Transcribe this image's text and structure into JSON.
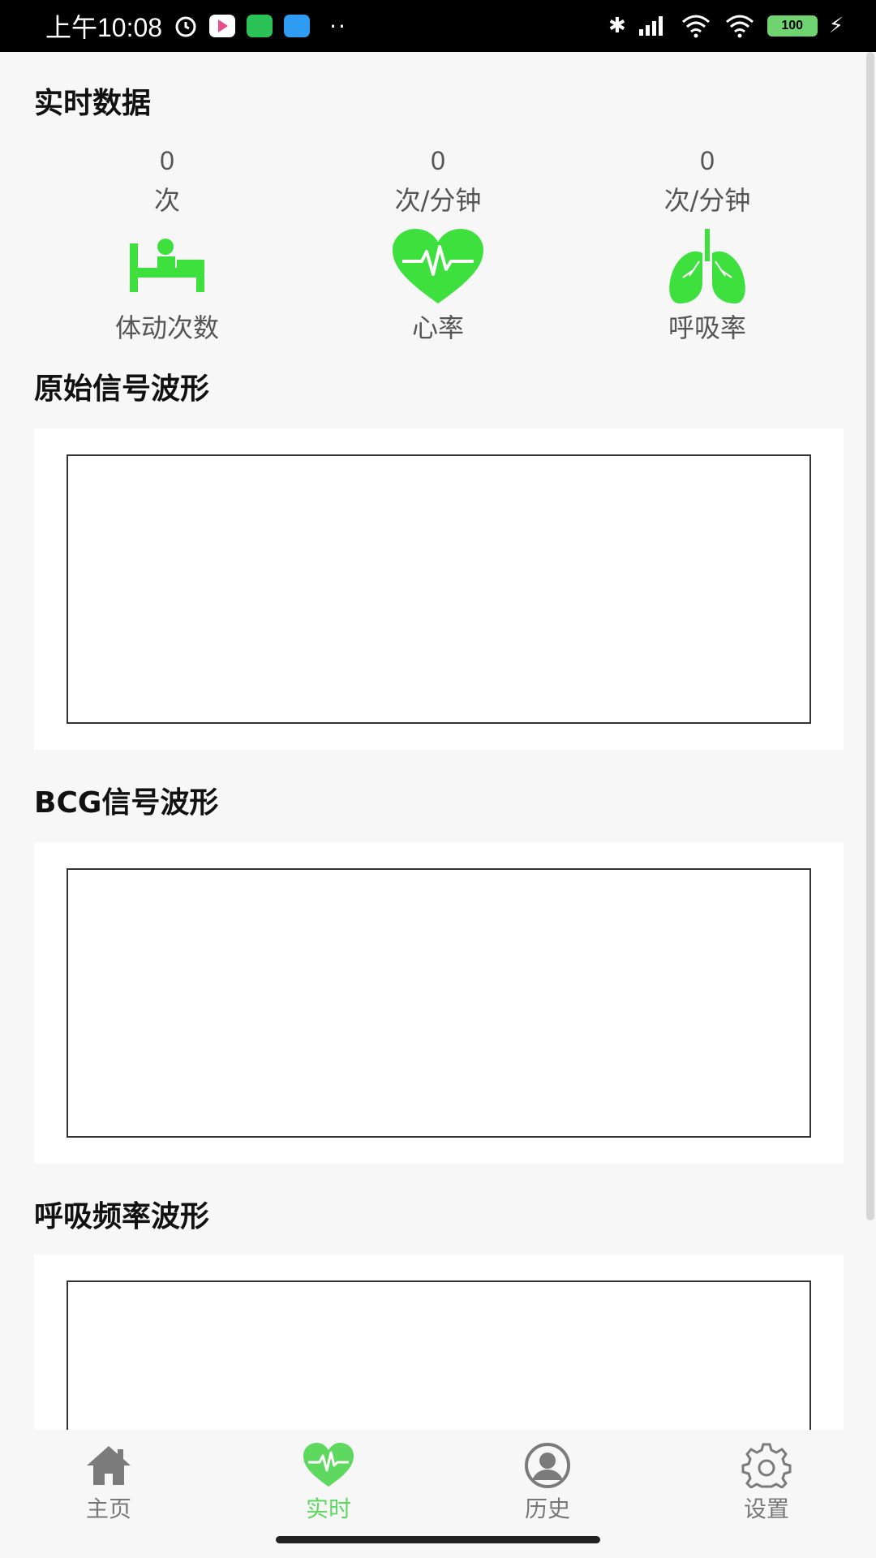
{
  "status_bar": {
    "time": "上午10:08",
    "battery": "100",
    "dots": "··"
  },
  "realtime": {
    "title": "实时数据",
    "stats": [
      {
        "value": "0",
        "unit": "次",
        "label": "体动次数",
        "icon": "bed-icon"
      },
      {
        "value": "0",
        "unit": "次/分钟",
        "label": "心率",
        "icon": "heart-pulse-icon"
      },
      {
        "value": "0",
        "unit": "次/分钟",
        "label": "呼吸率",
        "icon": "lungs-icon"
      }
    ]
  },
  "charts": [
    {
      "title": "原始信号波形"
    },
    {
      "title": "BCG信号波形"
    },
    {
      "title": "呼吸频率波形"
    }
  ],
  "bottom_nav": {
    "items": [
      {
        "label": "主页",
        "icon": "home-icon",
        "active": false
      },
      {
        "label": "实时",
        "icon": "heart-pulse-icon",
        "active": true
      },
      {
        "label": "历史",
        "icon": "user-icon",
        "active": false
      },
      {
        "label": "设置",
        "icon": "gear-icon",
        "active": false
      }
    ]
  },
  "colors": {
    "accent_green": "#3ee03e",
    "active_tab": "#5fd85f",
    "inactive_tab": "#777777"
  }
}
